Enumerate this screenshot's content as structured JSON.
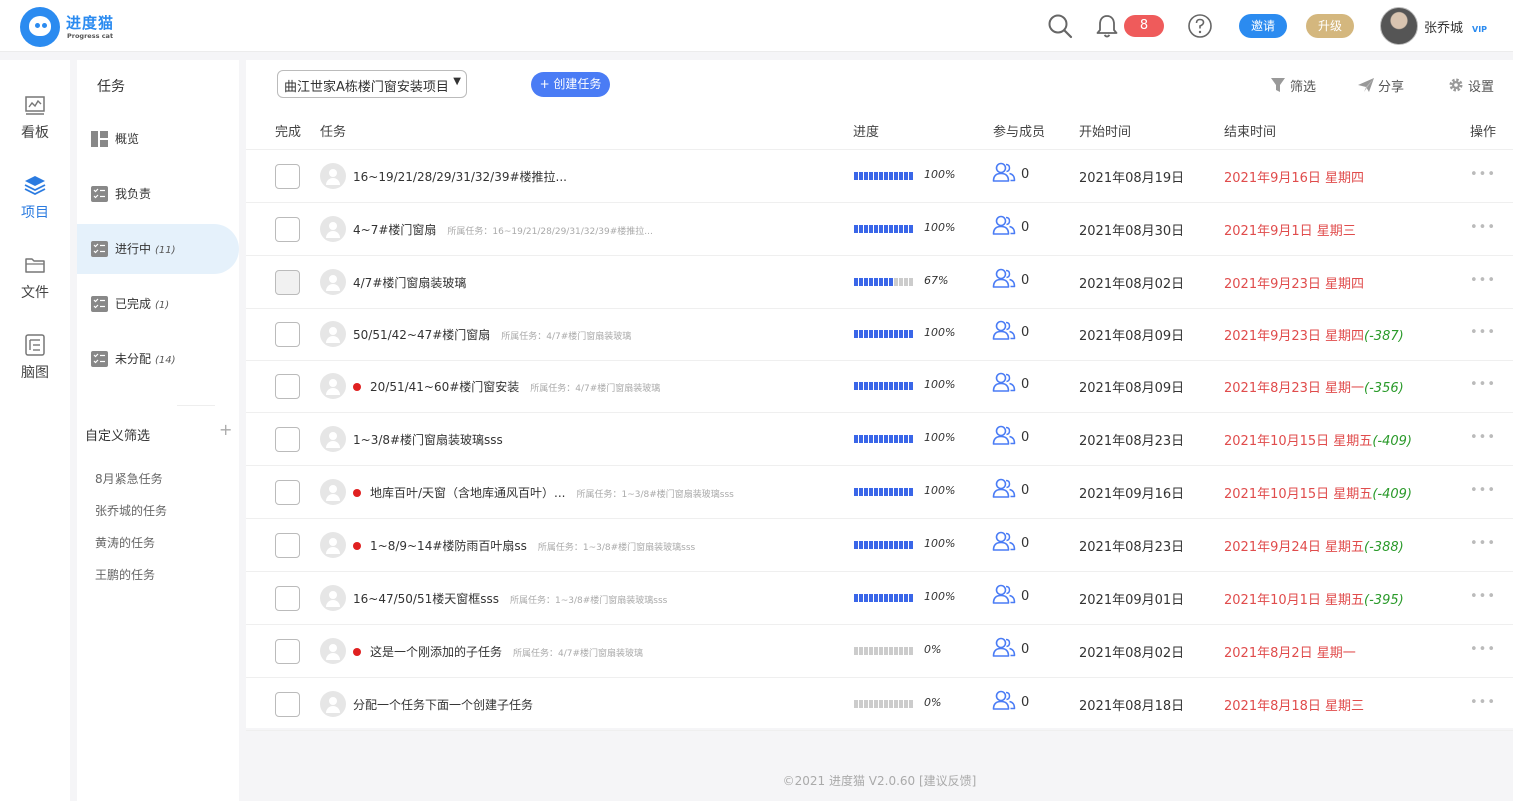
{
  "header": {
    "logo_title": "进度猫",
    "logo_sub": "Progress cat",
    "notification_count": "8",
    "invite_label": "邀请",
    "upgrade_label": "升级",
    "user_name": "张乔城",
    "vip_label": "VIP"
  },
  "nav": {
    "items": [
      {
        "label": "看板",
        "icon": "chart-icon"
      },
      {
        "label": "项目",
        "icon": "layers-icon"
      },
      {
        "label": "文件",
        "icon": "folder-icon"
      },
      {
        "label": "脑图",
        "icon": "mindmap-icon"
      }
    ]
  },
  "subnav": {
    "title": "任务",
    "items": [
      {
        "label": "概览",
        "count": ""
      },
      {
        "label": "我负责",
        "count": ""
      },
      {
        "label": "进行中",
        "count": "(11)"
      },
      {
        "label": "已完成",
        "count": "(1)"
      },
      {
        "label": "未分配",
        "count": "(14)"
      }
    ],
    "custom_title": "自定义筛选",
    "custom_add": "+",
    "filters": [
      "8月紧急任务",
      "张乔城的任务",
      "黄涛的任务",
      "王鹏的任务"
    ]
  },
  "toolbar": {
    "project_name": "曲江世家A栋楼门窗安装项目",
    "create_label": "+ 创建任务",
    "filter_label": "筛选",
    "share_label": "分享",
    "settings_label": "设置"
  },
  "table": {
    "columns": {
      "done": "完成",
      "task": "任务",
      "progress": "进度",
      "members": "参与成员",
      "start": "开始时间",
      "end": "结束时间",
      "ops": "操作"
    },
    "rows": [
      {
        "name": "16~19/21/28/29/31/32/39#楼推拉...",
        "parent": "",
        "dot": false,
        "progress": 100,
        "pct": "100%",
        "members": "0",
        "start": "2021年08月19日",
        "end": "2021年9月16日 星期四",
        "over": "",
        "gray": false
      },
      {
        "name": "4~7#楼门窗扇",
        "parent": "所属任务：16~19/21/28/29/31/32/39#楼推拉...",
        "dot": false,
        "progress": 100,
        "pct": "100%",
        "members": "0",
        "start": "2021年08月30日",
        "end": "2021年9月1日 星期三",
        "over": "",
        "gray": false
      },
      {
        "name": "4/7#楼门窗扇装玻璃",
        "parent": "",
        "dot": false,
        "progress": 67,
        "pct": "67%",
        "members": "0",
        "start": "2021年08月02日",
        "end": "2021年9月23日 星期四",
        "over": "",
        "gray": true
      },
      {
        "name": "50/51/42~47#楼门窗扇",
        "parent": "所属任务：4/7#楼门窗扇装玻璃",
        "dot": false,
        "progress": 100,
        "pct": "100%",
        "members": "0",
        "start": "2021年08月09日",
        "end": "2021年9月23日 星期四",
        "over": "(-387)",
        "gray": false
      },
      {
        "name": "20/51/41~60#楼门窗安装",
        "parent": "所属任务：4/7#楼门窗扇装玻璃",
        "dot": true,
        "progress": 100,
        "pct": "100%",
        "members": "0",
        "start": "2021年08月09日",
        "end": "2021年8月23日 星期一",
        "over": "(-356)",
        "gray": false
      },
      {
        "name": "1~3/8#楼门窗扇装玻璃sss",
        "parent": "",
        "dot": false,
        "progress": 100,
        "pct": "100%",
        "members": "0",
        "start": "2021年08月23日",
        "end": "2021年10月15日 星期五",
        "over": "(-409)",
        "gray": false
      },
      {
        "name": "地库百叶/天窗（含地库通风百叶）...",
        "parent": "所属任务：1~3/8#楼门窗扇装玻璃sss",
        "dot": true,
        "progress": 100,
        "pct": "100%",
        "members": "0",
        "start": "2021年09月16日",
        "end": "2021年10月15日 星期五",
        "over": "(-409)",
        "gray": false
      },
      {
        "name": "1~8/9~14#楼防雨百叶扇ss",
        "parent": "所属任务：1~3/8#楼门窗扇装玻璃sss",
        "dot": true,
        "progress": 100,
        "pct": "100%",
        "members": "0",
        "start": "2021年08月23日",
        "end": "2021年9月24日 星期五",
        "over": "(-388)",
        "gray": false
      },
      {
        "name": "16~47/50/51楼天窗框sss",
        "parent": "所属任务：1~3/8#楼门窗扇装玻璃sss",
        "dot": false,
        "progress": 100,
        "pct": "100%",
        "members": "0",
        "start": "2021年09月01日",
        "end": "2021年10月1日 星期五",
        "over": "(-395)",
        "gray": false
      },
      {
        "name": "这是一个刚添加的子任务",
        "parent": "所属任务：4/7#楼门窗扇装玻璃",
        "dot": true,
        "progress": 0,
        "pct": "0%",
        "members": "0",
        "start": "2021年08月02日",
        "end": "2021年8月2日 星期一",
        "over": "",
        "gray": false
      },
      {
        "name": "分配一个任务下面一个创建子任务",
        "parent": "",
        "dot": false,
        "progress": 0,
        "pct": "0%",
        "members": "0",
        "start": "2021年08月18日",
        "end": "2021年8月18日 星期三",
        "over": "",
        "gray": false
      }
    ],
    "ops_label": "•••"
  },
  "footer": {
    "copyright": "©2021 进度猫 V2.0.60",
    "feedback": "[建议反馈]"
  }
}
